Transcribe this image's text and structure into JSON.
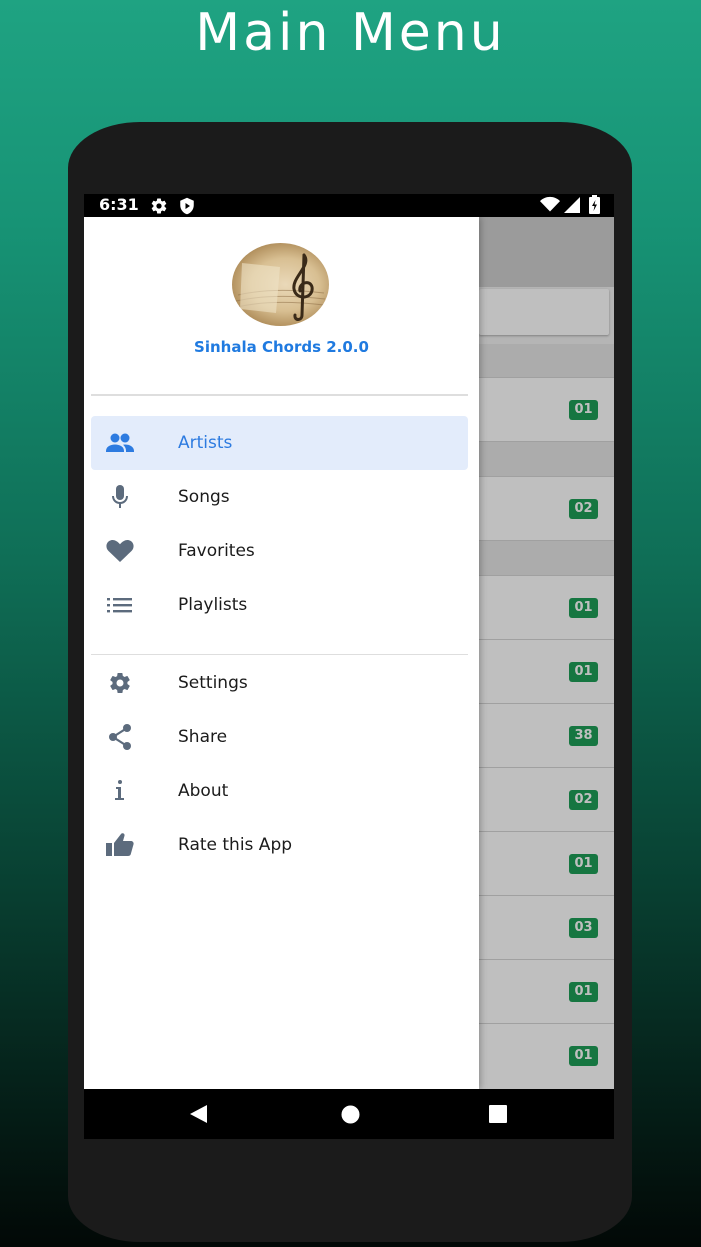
{
  "promo": {
    "title": "Main Menu"
  },
  "status_bar": {
    "time": "6:31",
    "left_icons": [
      "gear-icon",
      "shield-play-icon"
    ],
    "right_icons": [
      "wifi-icon",
      "signal-icon",
      "battery-icon"
    ]
  },
  "drawer": {
    "app_name": "Sinhala Chords 2.0.0",
    "primary_items": [
      {
        "label": "Artists",
        "icon": "people-icon",
        "active": true
      },
      {
        "label": "Songs",
        "icon": "microphone-icon",
        "active": false
      },
      {
        "label": "Favorites",
        "icon": "heart-icon",
        "active": false
      },
      {
        "label": "Playlists",
        "icon": "list-icon",
        "active": false
      }
    ],
    "secondary_items": [
      {
        "label": "Settings",
        "icon": "gear-icon"
      },
      {
        "label": "Share",
        "icon": "share-icon"
      },
      {
        "label": "About",
        "icon": "info-icon"
      },
      {
        "label": "Rate this App",
        "icon": "thumbs-up-icon"
      }
    ]
  },
  "background_list": {
    "badges": [
      "01",
      "02",
      "01",
      "01",
      "38",
      "02",
      "01",
      "03",
      "01",
      "01"
    ]
  },
  "nav_bar": {
    "icons": [
      "back-icon",
      "home-icon",
      "recents-icon"
    ]
  },
  "colors": {
    "accent": "#1f7ae0",
    "active_bg": "#e3ecfb",
    "badge": "#1e9e57",
    "icon": "#5c6b7d",
    "promo_bg_top": "#1fa382"
  }
}
